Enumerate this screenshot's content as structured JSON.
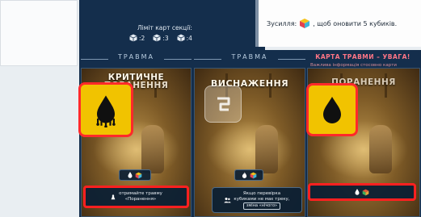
{
  "limits": {
    "title": "Ліміт карт секції:",
    "items": [
      {
        "icon": "white-cube-icon",
        "value": ":2"
      },
      {
        "icon": "white-cube-icon",
        "value": ":3"
      },
      {
        "icon": "white-cube-icon",
        "value": ":4"
      }
    ]
  },
  "effort": {
    "prefix": "Зусилля:",
    "suffix": ", щоб оновити 5 кубиків."
  },
  "sections": [
    {
      "header": "ТРАВМА"
    },
    {
      "header": "ТРАВМА"
    },
    {
      "header": "КАРТА ТРАВМИ – УВАГА!",
      "subtitle": "Важлива інформація стосовно карти"
    }
  ],
  "cards": [
    {
      "title_line1": "КРИТИЧНЕ",
      "title_line2": "ПОРАНЕННЯ",
      "icon": "bleeding-drop-icon",
      "cost_icons": [
        "blood-drop-icon",
        "multicolor-cube-icon"
      ],
      "effect": {
        "line1": "отримайте травму",
        "line2": "«Поранення»"
      }
    },
    {
      "title": "ВИСНАЖЕННЯ",
      "icon": "swirl-icon",
      "cost_icons": [
        "flame-icon",
        "multicolor-cube-icon"
      ],
      "effect": {
        "line1": "Якщо перевірка",
        "line2": "кубиками не має треку,",
        "line3": "зміна «нічого»"
      }
    },
    {
      "title": "ПОРАНЕННЯ",
      "icon": "blood-drop-icon",
      "cost_icons": [
        "blood-drop-icon",
        "colored-cube-icon"
      ]
    }
  ],
  "colors": {
    "navy": "#142e4c",
    "highlight_red": "#ff2020",
    "icon_yellow": "#f1c300",
    "warning_red": "#ff7686"
  }
}
